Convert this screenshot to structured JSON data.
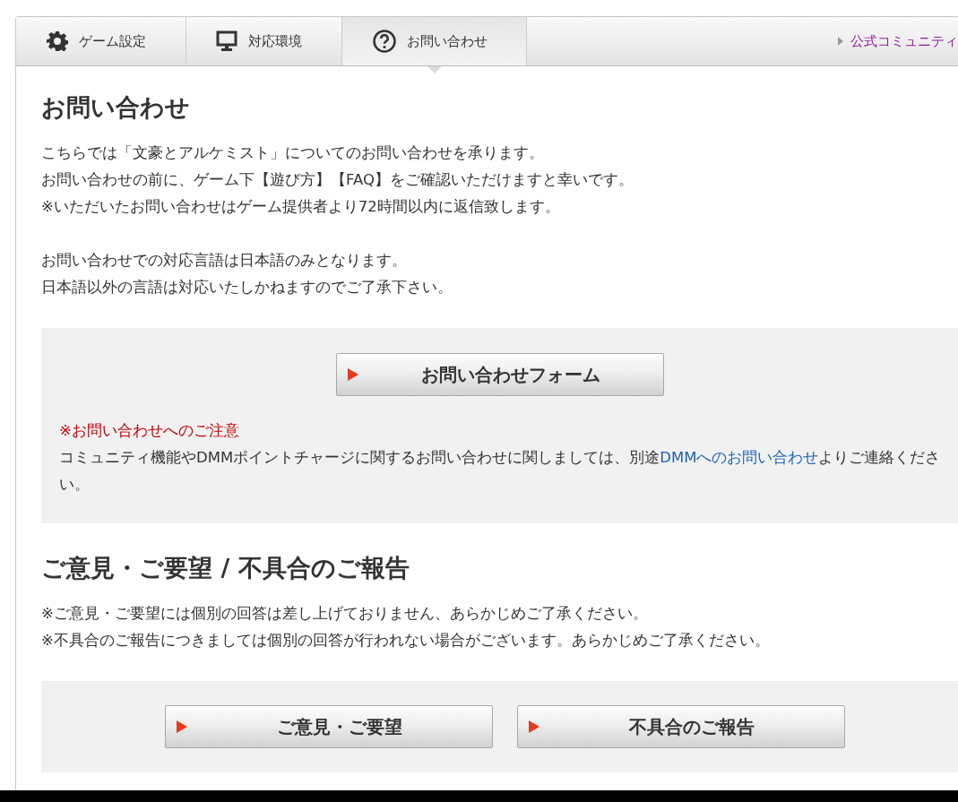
{
  "tabs": [
    {
      "label": "ゲーム設定",
      "kind": "settings",
      "selected": false
    },
    {
      "label": "対応環境",
      "kind": "environment",
      "selected": false
    },
    {
      "label": "お問い合わせ",
      "kind": "contact",
      "selected": true
    }
  ],
  "community_link": "公式コミュニティ",
  "contact": {
    "heading": "お問い合わせ",
    "paragraphs": [
      [
        "こちらでは「文豪とアルケミスト」についてのお問い合わせを承ります。",
        "お問い合わせの前に、ゲーム下【遊び方】【FAQ】をご確認いただけますと幸いです。",
        "※いただいたお問い合わせはゲーム提供者より72時間以内に返信致します。"
      ],
      [
        "お問い合わせでの対応言語は日本語のみとなります。",
        "日本語以外の言語は対応いたしかねますのでご了承下さい。"
      ]
    ],
    "form_button": "お問い合わせフォーム",
    "notice_title": "※お問い合わせへのご注意",
    "notice": {
      "before": "コミュニティ機能やDMMポイントチャージに関するお問い合わせに関しましては、別途",
      "link": "DMMへのお問い合わせ",
      "after": "よりご連絡ください。"
    }
  },
  "feedback": {
    "heading": "ご意見・ご要望 / 不具合のご報告",
    "lines": [
      "※ご意見・ご要望には個別の回答は差し上げておりません、あらかじめご了承ください。",
      "※不具合のご報告につきましては個別の回答が行われない場合がございます。あらかじめご了承ください。"
    ],
    "buttons": [
      "ご意見・ご要望",
      "不具合のご報告"
    ]
  }
}
